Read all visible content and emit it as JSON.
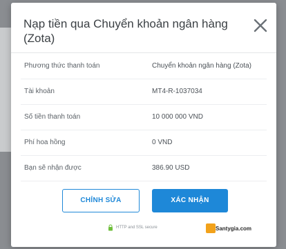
{
  "modal": {
    "title": "Nạp tiền qua Chuyển khoản ngân hàng (Zota)",
    "close_icon": "close-icon"
  },
  "rows": [
    {
      "label": "Phương thức thanh toán",
      "value": "Chuyển khoản ngân hàng (Zota)"
    },
    {
      "label": "Tài khoản",
      "value": "MT4-R-1037034"
    },
    {
      "label": "Số tiền thanh toán",
      "value": "10 000 000 VND"
    },
    {
      "label": "Phí hoa hồng",
      "value": "0 VND"
    },
    {
      "label": "Bạn sẽ nhận được",
      "value": "386.90 USD"
    }
  ],
  "actions": {
    "edit_label": "CHỈNH SỬA",
    "confirm_label": "XÁC NHẬN"
  },
  "footer": {
    "secure_text": "HTTP and SSL secure",
    "lock_icon": "lock-icon"
  },
  "watermark": {
    "text": "Santygia.com"
  },
  "colors": {
    "accent": "#1e88d8",
    "backdrop": "#8a8d91"
  }
}
